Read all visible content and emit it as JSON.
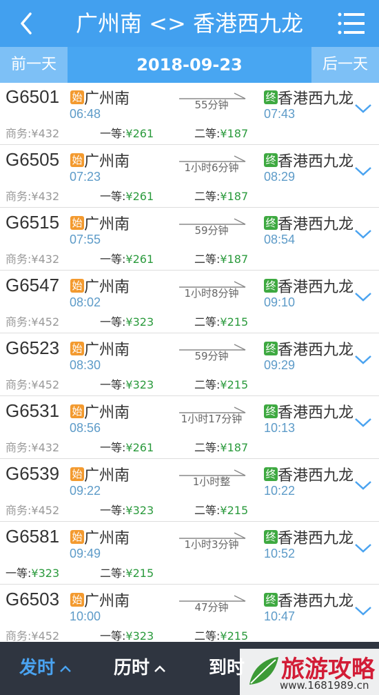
{
  "header": {
    "title": "广州南 <> 香港西九龙",
    "back_icon": "chevron-left-icon",
    "menu_icon": "menu-icon"
  },
  "datebar": {
    "prev_label": "前一天",
    "date": "2018-09-23",
    "next_label": "后一天"
  },
  "trains": [
    {
      "no": "G6501",
      "from": "广州南",
      "dep": "06:48",
      "duration": "55分钟",
      "to": "香港西九龙",
      "arr": "07:43",
      "biz_label": "商务:",
      "biz_price": "¥432",
      "first_label": "一等:",
      "first_price": "¥261",
      "second_label": "二等:",
      "second_price": "¥187"
    },
    {
      "no": "G6505",
      "from": "广州南",
      "dep": "07:23",
      "duration": "1小时6分钟",
      "to": "香港西九龙",
      "arr": "08:29",
      "biz_label": "商务:",
      "biz_price": "¥432",
      "first_label": "一等:",
      "first_price": "¥261",
      "second_label": "二等:",
      "second_price": "¥187"
    },
    {
      "no": "G6515",
      "from": "广州南",
      "dep": "07:55",
      "duration": "59分钟",
      "to": "香港西九龙",
      "arr": "08:54",
      "biz_label": "商务:",
      "biz_price": "¥432",
      "first_label": "一等:",
      "first_price": "¥261",
      "second_label": "二等:",
      "second_price": "¥187"
    },
    {
      "no": "G6547",
      "from": "广州南",
      "dep": "08:02",
      "duration": "1小时8分钟",
      "to": "香港西九龙",
      "arr": "09:10",
      "biz_label": "商务:",
      "biz_price": "¥452",
      "first_label": "一等:",
      "first_price": "¥323",
      "second_label": "二等:",
      "second_price": "¥215"
    },
    {
      "no": "G6523",
      "from": "广州南",
      "dep": "08:30",
      "duration": "59分钟",
      "to": "香港西九龙",
      "arr": "09:29",
      "biz_label": "商务:",
      "biz_price": "¥452",
      "first_label": "一等:",
      "first_price": "¥323",
      "second_label": "二等:",
      "second_price": "¥215"
    },
    {
      "no": "G6531",
      "from": "广州南",
      "dep": "08:56",
      "duration": "1小时17分钟",
      "to": "香港西九龙",
      "arr": "10:13",
      "biz_label": "商务:",
      "biz_price": "¥432",
      "first_label": "一等:",
      "first_price": "¥261",
      "second_label": "二等:",
      "second_price": "¥187"
    },
    {
      "no": "G6539",
      "from": "广州南",
      "dep": "09:22",
      "duration": "1小时整",
      "to": "香港西九龙",
      "arr": "10:22",
      "biz_label": "商务:",
      "biz_price": "¥452",
      "first_label": "一等:",
      "first_price": "¥323",
      "second_label": "二等:",
      "second_price": "¥215"
    },
    {
      "no": "G6581",
      "from": "广州南",
      "dep": "09:49",
      "duration": "1小时3分钟",
      "to": "香港西九龙",
      "arr": "10:52",
      "biz_label": "",
      "biz_price": "",
      "first_label": "一等:",
      "first_price": "¥323",
      "second_label": "二等:",
      "second_price": "¥215"
    },
    {
      "no": "G6503",
      "from": "广州南",
      "dep": "10:00",
      "duration": "47分钟",
      "to": "香港西九龙",
      "arr": "10:47",
      "biz_label": "商务:",
      "biz_price": "¥452",
      "first_label": "一等:",
      "first_price": "¥323",
      "second_label": "二等:",
      "second_price": "¥215"
    }
  ],
  "tags": {
    "start": "始",
    "end": "终"
  },
  "bottom": {
    "sort_depart": "发时",
    "sort_duration": "历时",
    "sort_arrive": "到时"
  },
  "watermark": {
    "text": "旅游攻略",
    "url": "www.1681989.cn"
  },
  "colors": {
    "header": "#42a0ef",
    "price": "#2a9a3c",
    "time": "#5d9bc8",
    "start_tag": "#f39a2f",
    "end_tag": "#3ea941",
    "bottom_bar": "#2f3540",
    "active_sort": "#4aa3f0"
  }
}
